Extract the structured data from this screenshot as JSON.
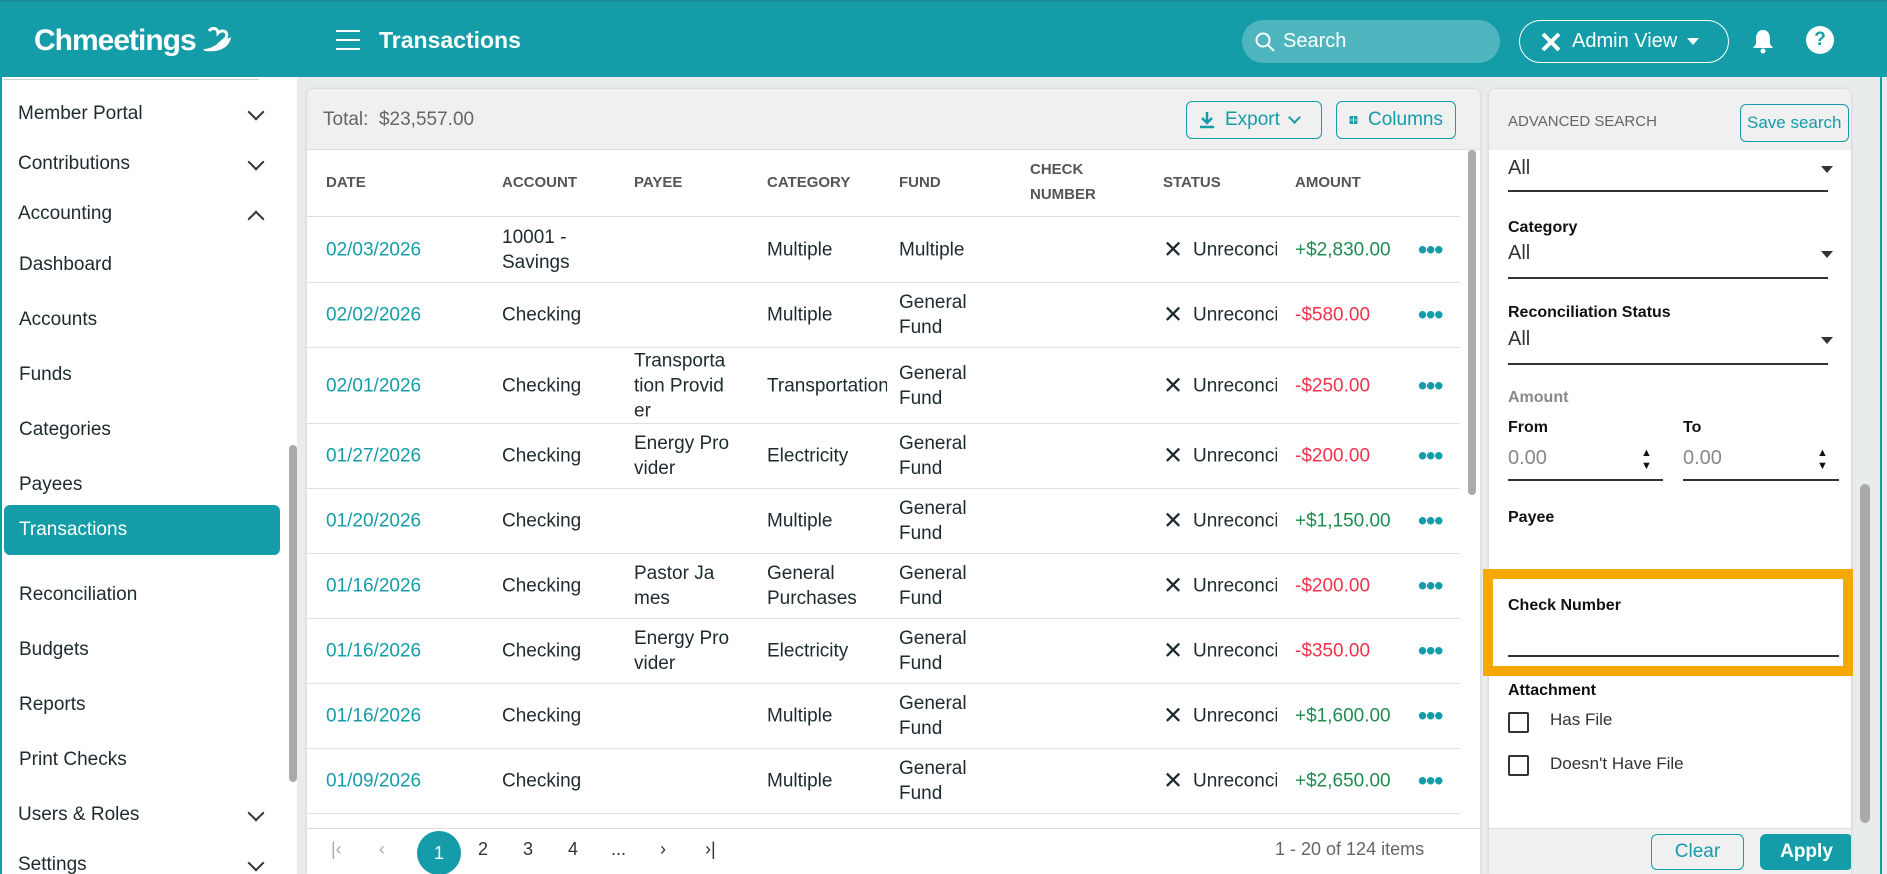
{
  "app": {
    "logo": "Chmeetings",
    "page_title": "Transactions",
    "search_placeholder": "Search",
    "admin_view": "Admin View"
  },
  "colors": {
    "brand": "#149ca8",
    "positive": "#1e8c4e",
    "negative": "#f0334a",
    "highlight": "#f5a800"
  },
  "sidebar": {
    "items": [
      {
        "label": "Member Portal",
        "type": "group",
        "state": "collapsed"
      },
      {
        "label": "Contributions",
        "type": "group",
        "state": "collapsed"
      },
      {
        "label": "Accounting",
        "type": "group",
        "state": "expanded"
      },
      {
        "label": "Dashboard"
      },
      {
        "label": "Accounts"
      },
      {
        "label": "Funds"
      },
      {
        "label": "Categories"
      },
      {
        "label": "Payees"
      },
      {
        "label": "Transactions",
        "selected": true
      },
      {
        "label": "Reconciliation"
      },
      {
        "label": "Budgets"
      },
      {
        "label": "Reports"
      },
      {
        "label": "Print Checks"
      },
      {
        "label": "Users & Roles",
        "type": "group",
        "state": "collapsed"
      },
      {
        "label": "Settings",
        "type": "group",
        "state": "collapsed"
      }
    ]
  },
  "table": {
    "total_label": "Total:",
    "total": "$23,557.00",
    "export": "Export",
    "columns_btn": "Columns",
    "headers": [
      "DATE",
      "ACCOUNT",
      "PAYEE",
      "CATEGORY",
      "FUND",
      "CHECK NUMBER",
      "STATUS",
      "AMOUNT"
    ],
    "rows": [
      {
        "date": "02/03/2026",
        "account": "10001 - Savings",
        "payee": "",
        "category": "Multiple",
        "fund": "Multiple",
        "check": "",
        "status": "Unreconciled",
        "amount": "+$2,830.00"
      },
      {
        "date": "02/02/2026",
        "account": "Checking",
        "payee": "",
        "category": "Multiple",
        "fund": "General Fund",
        "check": "",
        "status": "Unreconciled",
        "amount": "-$580.00"
      },
      {
        "date": "02/01/2026",
        "account": "Checking",
        "payee": "Transportation Provider",
        "category": "Transportation",
        "fund": "General Fund",
        "check": "",
        "status": "Unreconciled",
        "amount": "-$250.00"
      },
      {
        "date": "01/27/2026",
        "account": "Checking",
        "payee": "Energy Provider",
        "category": "Electricity",
        "fund": "General Fund",
        "check": "",
        "status": "Unreconciled",
        "amount": "-$200.00"
      },
      {
        "date": "01/20/2026",
        "account": "Checking",
        "payee": "",
        "category": "Multiple",
        "fund": "General Fund",
        "check": "",
        "status": "Unreconciled",
        "amount": "+$1,150.00"
      },
      {
        "date": "01/16/2026",
        "account": "Checking",
        "payee": "Pastor James",
        "category": "General Purchases",
        "fund": "General Fund",
        "check": "",
        "status": "Unreconciled",
        "amount": "-$200.00"
      },
      {
        "date": "01/16/2026",
        "account": "Checking",
        "payee": "Energy Provider",
        "category": "Electricity",
        "fund": "General Fund",
        "check": "",
        "status": "Unreconciled",
        "amount": "-$350.00"
      },
      {
        "date": "01/16/2026",
        "account": "Checking",
        "payee": "",
        "category": "Multiple",
        "fund": "General Fund",
        "check": "",
        "status": "Unreconciled",
        "amount": "+$1,600.00"
      },
      {
        "date": "01/09/2026",
        "account": "Checking",
        "payee": "",
        "category": "Multiple",
        "fund": "General Fund",
        "check": "",
        "status": "Unreconciled",
        "amount": "+$2,650.00"
      }
    ],
    "pager": {
      "pages": [
        "1",
        "2",
        "3",
        "4",
        "..."
      ],
      "current": "1",
      "summary": "1 - 20 of 124 items"
    }
  },
  "search": {
    "title": "ADVANCED SEARCH",
    "save": "Save search",
    "top_value": "All",
    "category_label": "Category",
    "category_value": "All",
    "recon_label": "Reconciliation Status",
    "recon_value": "All",
    "amount_label": "Amount",
    "from_label": "From",
    "to_label": "To",
    "from_placeholder": "0.00",
    "to_placeholder": "0.00",
    "payee_label": "Payee",
    "check_label": "Check Number",
    "check_value": "",
    "attachment_label": "Attachment",
    "has_file": "Has File",
    "no_file": "Doesn't Have File",
    "clear": "Clear",
    "apply": "Apply"
  }
}
